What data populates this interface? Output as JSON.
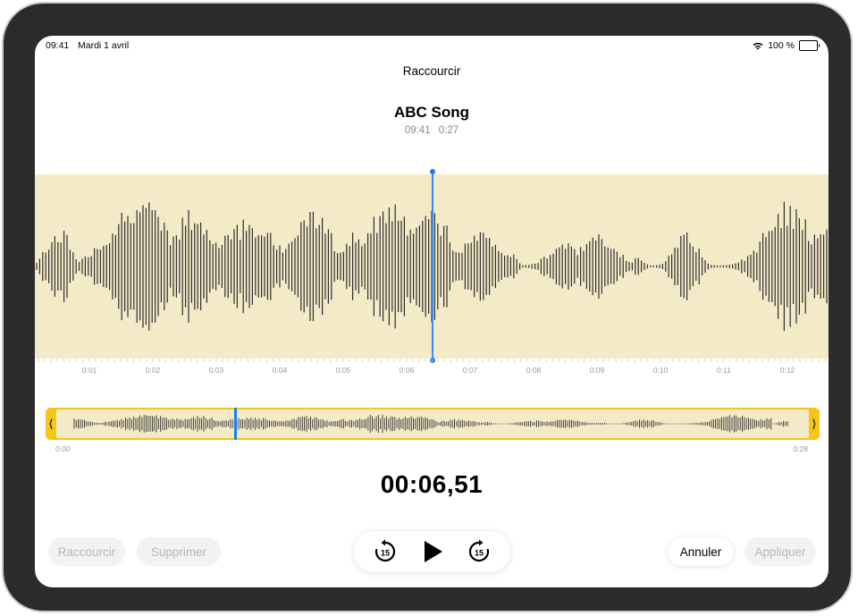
{
  "status_bar": {
    "time": "09:41",
    "date": "Mardi 1 avril",
    "battery": "100 %"
  },
  "nav": {
    "title": "Raccourcir"
  },
  "recording": {
    "title": "ABC Song",
    "time": "09:41",
    "duration": "0:27"
  },
  "timeline": {
    "tick_labels": [
      "0:01",
      "0:02",
      "0:03",
      "0:04",
      "0:05",
      "0:06",
      "0:07",
      "0:08",
      "0:09",
      "0:10",
      "0:11",
      "0:12"
    ],
    "start_label": "0:00",
    "end_label": "0:28"
  },
  "playback": {
    "current_time": "00:06,51"
  },
  "actions": {
    "trim_label": "Raccourcir",
    "delete_label": "Supprimer",
    "cancel_label": "Annuler",
    "apply_label": "Appliquer"
  },
  "controls": {
    "skip_back_seconds": "15",
    "skip_forward_seconds": "15"
  },
  "colors": {
    "accent": "#f5c518",
    "playhead": "#1a7cf5",
    "wave_bg": "#f3eac8",
    "wave": "#2e2e2e"
  }
}
